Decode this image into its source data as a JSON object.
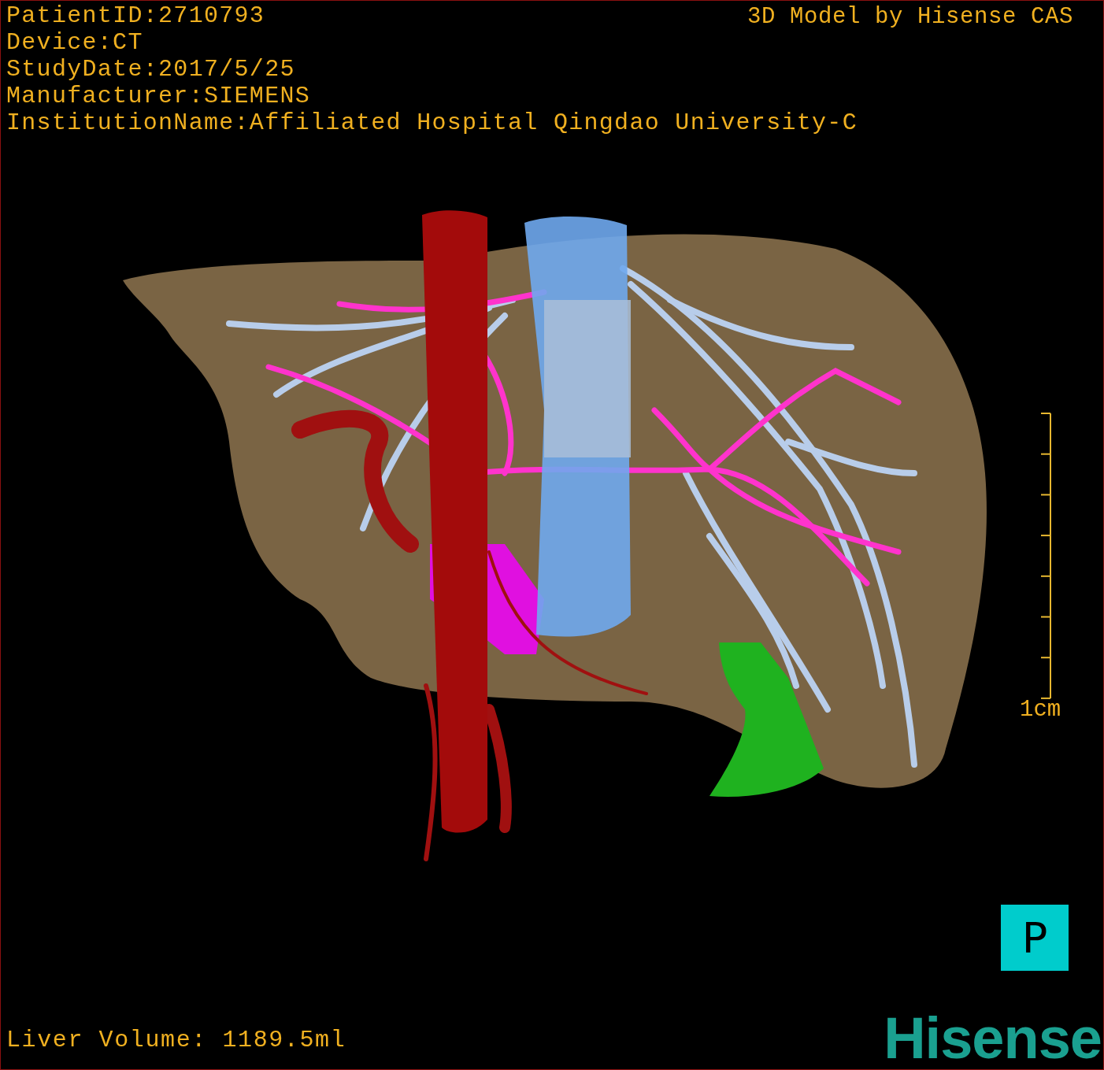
{
  "info_lines": [
    "PatientID:2710793",
    "Device:CT",
    "StudyDate:2017/5/25",
    "Manufacturer:SIEMENS",
    "InstitutionName:Affiliated Hospital Qingdao University-C"
  ],
  "title": "3D Model by Hisense CAS",
  "scale_bar": {
    "label": "1cm"
  },
  "view_button": {
    "label": "P"
  },
  "liver_volume": "Liver Volume: 1189.5ml",
  "logo": "Hisense"
}
